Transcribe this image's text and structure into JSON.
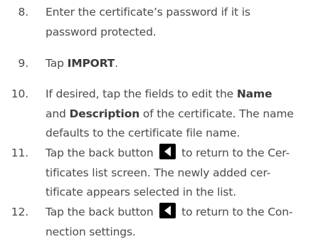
{
  "steps": [
    {
      "number": "8.",
      "line1": "Enter the certificate’s password if it is",
      "line2": "password protected."
    },
    {
      "number": "9.",
      "prefix": "Tap ",
      "bold": "IMPORT",
      "suffix": "."
    },
    {
      "number": "10.",
      "line1_prefix": "If desired, tap the fields to edit the ",
      "bold_name": "Name",
      "line2_prefix": "and ",
      "bold_description": "Description",
      "line2_suffix": " of the certificate. The name",
      "line3": "defaults to the certificate file name."
    },
    {
      "number": "11.",
      "line1_prefix": "Tap the back button ",
      "line1_suffix": " to return to the Cer-",
      "line2": "tificates list screen. The newly added cer-",
      "line3": "tificate appears selected in the list."
    },
    {
      "number": "12.",
      "line1_prefix": "Tap the back button ",
      "line1_suffix": " to return to the Con-",
      "line2": "nection settings."
    }
  ],
  "icons": {
    "back_button": "back-triangle-icon"
  },
  "colors": {
    "text": "#4a4a4a",
    "icon_bg": "#000000",
    "icon_fg": "#ffffff"
  }
}
